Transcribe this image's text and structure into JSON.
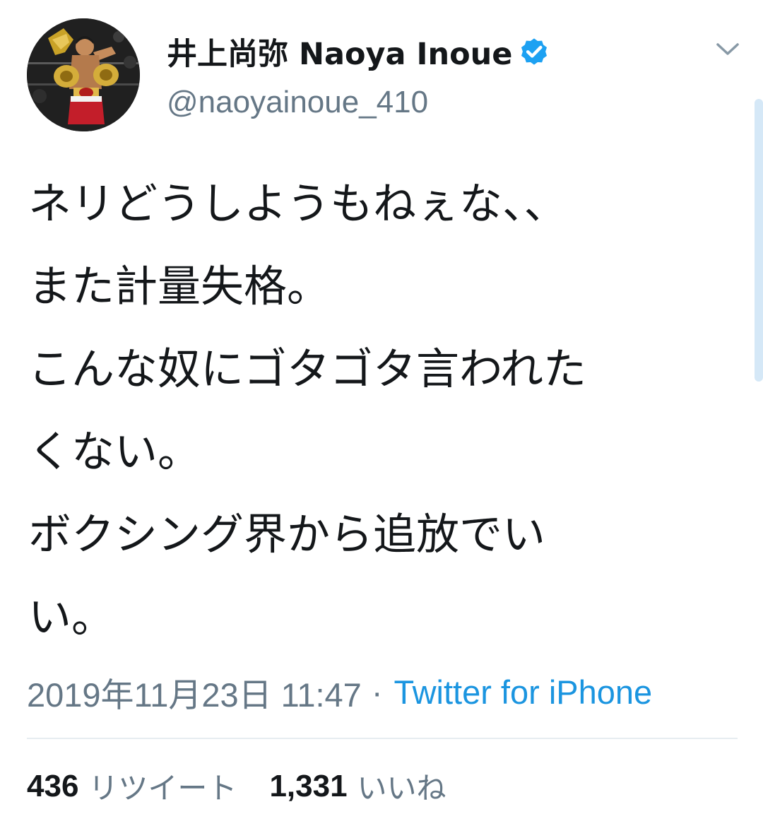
{
  "tweet": {
    "author": {
      "display_name": "井上尚弥  Naoya Inoue",
      "handle": "@naoyainoue_410",
      "verified": true,
      "avatar": "avatar-boxer-with-belts"
    },
    "menu_icon": "chevron-down-icon",
    "text_lines": [
      "ネリどうしようもねぇな、、",
      "また計量失格。",
      "こんな奴にゴタゴタ言われた",
      "くない。",
      "ボクシング界から追放でい",
      "い。"
    ],
    "meta": {
      "date": "2019年11月23日 11:47",
      "separator": "·",
      "source": "Twitter for iPhone"
    },
    "stats": {
      "retweets_count": "436",
      "retweets_label": "リツイート",
      "likes_count": "1,331",
      "likes_label": "いいね"
    }
  },
  "colors": {
    "text_primary": "#14171a",
    "text_secondary": "#657786",
    "link": "#1b95e0",
    "verified_badge": "#1da1f2",
    "divider": "#e6ecf0"
  }
}
